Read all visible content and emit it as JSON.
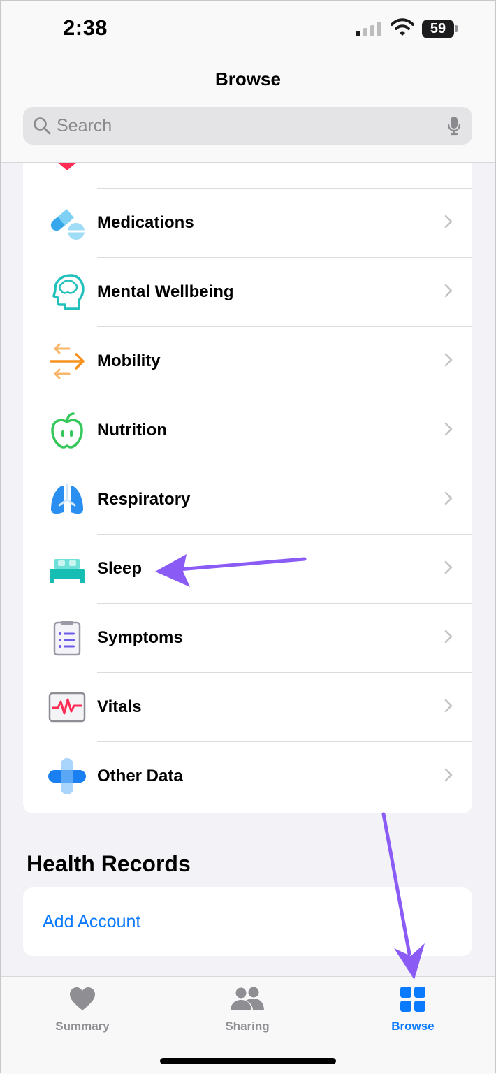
{
  "status": {
    "time": "2:38",
    "battery": "59"
  },
  "header": {
    "title": "Browse",
    "search_placeholder": "Search"
  },
  "categories": [
    {
      "label": "Medications",
      "icon": "pills-icon"
    },
    {
      "label": "Mental Wellbeing",
      "icon": "brain-head-icon"
    },
    {
      "label": "Mobility",
      "icon": "arrows-icon"
    },
    {
      "label": "Nutrition",
      "icon": "apple-icon"
    },
    {
      "label": "Respiratory",
      "icon": "lungs-icon"
    },
    {
      "label": "Sleep",
      "icon": "bed-icon"
    },
    {
      "label": "Symptoms",
      "icon": "clipboard-icon"
    },
    {
      "label": "Vitals",
      "icon": "vitals-monitor-icon"
    },
    {
      "label": "Other Data",
      "icon": "plus-icon"
    }
  ],
  "health_records": {
    "title": "Health Records",
    "add_account": "Add Account"
  },
  "tabs": [
    {
      "label": "Summary",
      "icon": "heart-icon",
      "active": false
    },
    {
      "label": "Sharing",
      "icon": "people-icon",
      "active": false
    },
    {
      "label": "Browse",
      "icon": "grid-icon",
      "active": true
    }
  ],
  "colors": {
    "accent": "#0a7aff",
    "annotation": "#8a5cf5",
    "inactive": "#8e8e93"
  }
}
